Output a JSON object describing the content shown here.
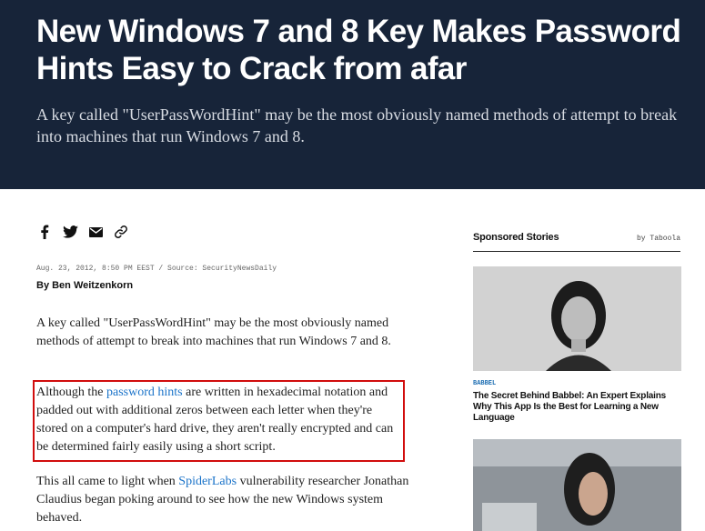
{
  "article": {
    "title": "New Windows 7 and 8 Key Makes Password Hints Easy to Crack from afar",
    "dek": "A key called \"UserPassWordHint\" may be the most obviously named methods of attempt to break into machines that run Windows 7 and 8.",
    "meta": "Aug. 23, 2012, 8:50 PM EEST / Source: SecurityNewsDaily",
    "byline": "By Ben Weitzenkorn",
    "p1": "A key called \"UserPassWordHint\" may be the most obviously named methods of attempt to break into machines that run Windows 7 and 8.",
    "p2_before": "Although the ",
    "p2_link": "password hints",
    "p2_after": " are written in hexadecimal notation and padded out with additional zeros between each letter when they're stored on a computer's hard drive, they aren't really encrypted and can be determined fairly easily using a short script.",
    "p3_before": "This all came to light when ",
    "p3_link": "SpiderLabs",
    "p3_after": " vulnerability researcher Jonathan Claudius began poking around to see how the new Windows system behaved."
  },
  "share": {
    "icons": [
      "facebook-icon",
      "twitter-icon",
      "mail-icon",
      "link-icon"
    ]
  },
  "sidebar": {
    "title": "Sponsored Stories",
    "by": "by Taboola",
    "cards": [
      {
        "kicker": "BABBEL",
        "title": "The Secret Behind Babbel: An Expert Explains Why This App Is the Best for Learning a New Language"
      },
      {
        "kicker": "",
        "title": ""
      }
    ]
  },
  "colors": {
    "hero_bg": "#172439",
    "link": "#1a73c9",
    "highlight_border": "#d10d0d"
  }
}
